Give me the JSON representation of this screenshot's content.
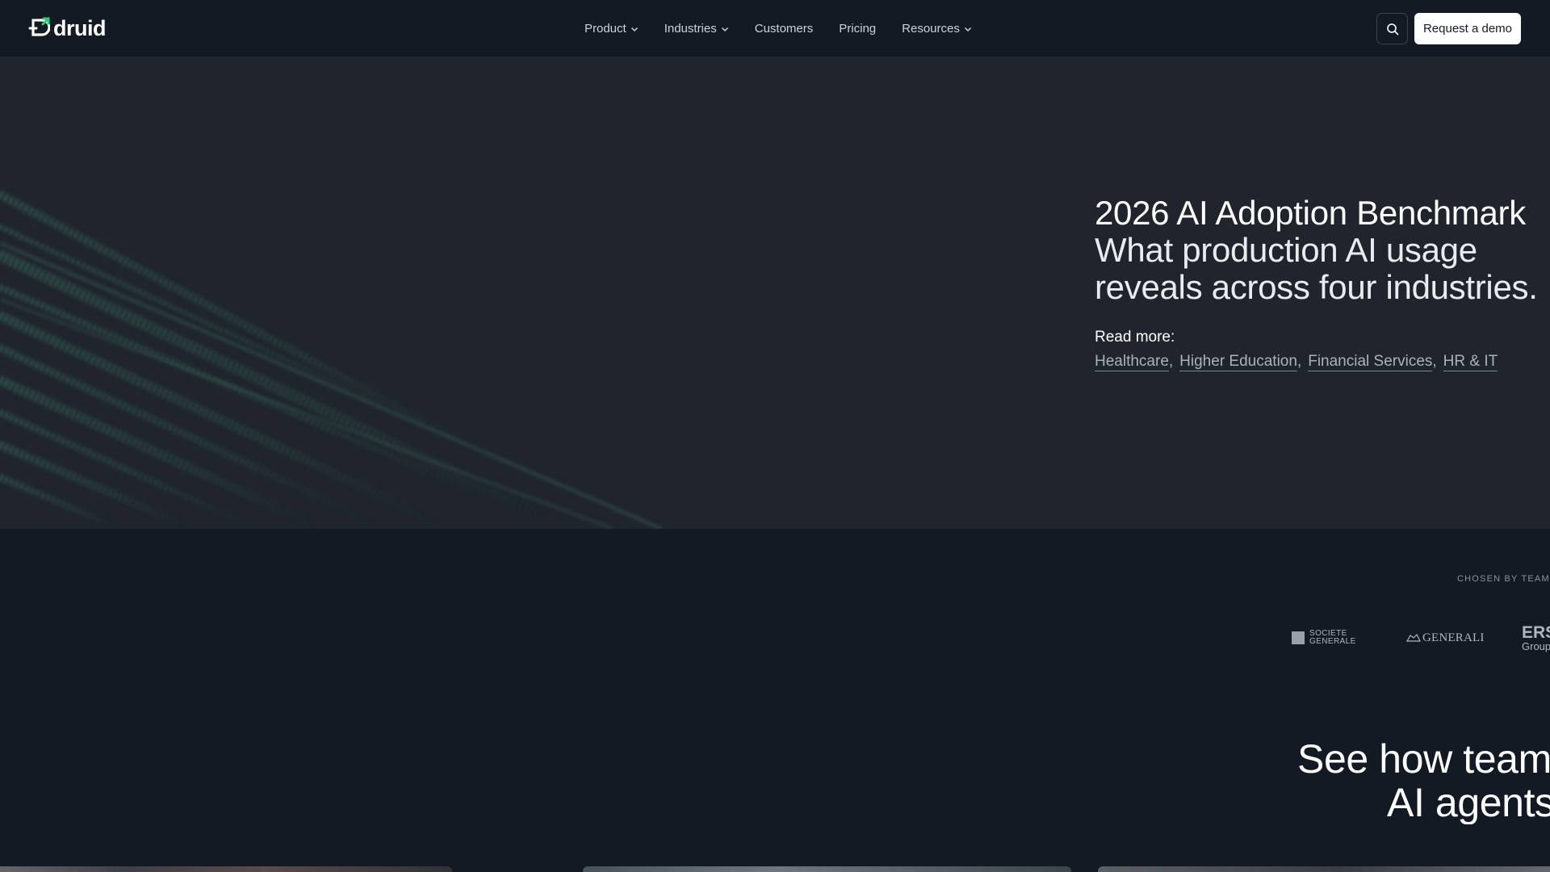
{
  "header": {
    "logo_text": "druid",
    "nav": [
      {
        "label": "Product",
        "has_dropdown": true
      },
      {
        "label": "Industries",
        "has_dropdown": true
      },
      {
        "label": "Customers",
        "has_dropdown": false
      },
      {
        "label": "Pricing",
        "has_dropdown": false
      },
      {
        "label": "Resources",
        "has_dropdown": true
      }
    ],
    "search_icon": "search-icon",
    "cta_label": "Request a demo"
  },
  "hero": {
    "title": "2026 AI Adoption Benchmark",
    "subtitle": "What production AI usage reveals across four industries.",
    "read_more_label": "Read more:",
    "links": [
      "Healthcare",
      "Higher Education",
      "Financial Services",
      "HR & IT"
    ]
  },
  "clients": {
    "caption": "CHOSEN BY TEAMS W",
    "logos": [
      {
        "name": "SOCIETE GENERALE",
        "line1": "SOCIETE",
        "line2": "GENERALE"
      },
      {
        "name": "GENERALI",
        "text": "GENERALI"
      },
      {
        "name": "ERSTE Group",
        "big": "ERS",
        "small": "Group"
      }
    ]
  },
  "teams_section": {
    "line1": "See how teams",
    "line2": "AI agents"
  },
  "colors": {
    "background": "#141a24",
    "hero_background": "#20252d",
    "brand_accent": "#34c77b",
    "cta_background": "#ffffff"
  }
}
